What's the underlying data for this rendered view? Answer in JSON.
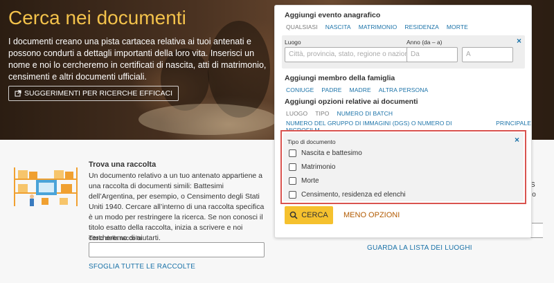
{
  "hero": {
    "title": "Cerca nei documenti",
    "description": "I documenti creano una pista cartacea relativa ai tuoi antenati e possono condurti a dettagli importanti della loro vita. Inserisci un nome e noi lo cercheremo in certificati di nascita, atti di matrimonio, censimenti e altri documenti ufficiali.",
    "tips_button": "SUGGERIMENTI PER RICERCHE EFFICACI"
  },
  "collection": {
    "title": "Trova una raccolta",
    "description": "Un documento relativo a un tuo antenato appartiene a una raccolta di documenti simili: Battesimi dell’Argentina, per esempio, o Censimento degli Stati Uniti 1940. Cercare all’interno di una raccolta specifica è un modo per restringere la ricerca. Se non conosci il titolo esatto della raccolta, inizia a scrivere e noi cercheremo di aiutarti.",
    "field_label": "Titolo della raccolta",
    "browse_link": "SFOGLIA TUTTE LE RACCOLTE"
  },
  "panel": {
    "event": {
      "title": "Aggiungi evento anagrafico",
      "options": [
        "QUALSIASI",
        "NASCITA",
        "MATRIMONIO",
        "RESIDENZA",
        "MORTE"
      ],
      "location_label": "Luogo",
      "location_placeholder": "Città, provincia, stato, regione o nazione",
      "year_label": "Anno (da – a)",
      "from_placeholder": "Da",
      "to_placeholder": "A"
    },
    "family": {
      "title": "Aggiungi membro della famiglia",
      "options": [
        "CONIUGE",
        "PADRE",
        "MADRE",
        "ALTRA PERSONA"
      ]
    },
    "doc_options": {
      "title": "Aggiungi opzioni relative ai documenti",
      "row1": [
        "LUOGO",
        "TIPO",
        "NUMERO DI BATCH"
      ],
      "row2": [
        "NUMERO DEL GRUPPO DI IMMAGINI (DGS) O NUMERO DI MICROFILM",
        "PRINCIPALE"
      ]
    },
    "doc_type": {
      "label": "Tipo di documento",
      "items": [
        "Nascita e battesimo",
        "Matrimonio",
        "Morte",
        "Censimento, residenza ed elenchi"
      ]
    },
    "search_button": "CERCA",
    "fewer_options": "MENO OPZIONI",
    "close_glyph": "×"
  },
  "places_link": "GUARDA LA LISTA DEI LUOGHI",
  "right_stub": {
    "line1": "S",
    "line2": "lo"
  },
  "colors": {
    "accent_yellow": "#f5c12e",
    "link_blue": "#1a72a8",
    "highlight_red": "#d9534f",
    "title_gold": "#f3c24b"
  }
}
